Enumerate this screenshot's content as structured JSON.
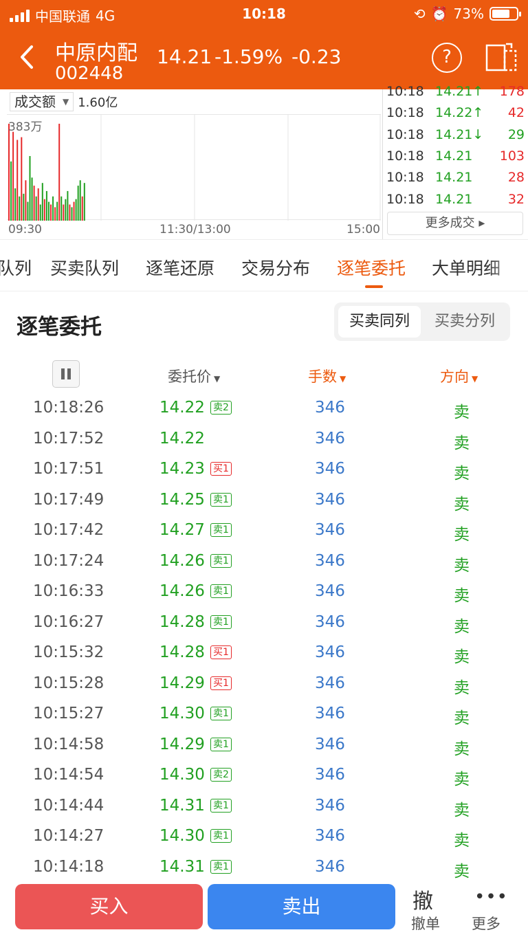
{
  "status_bar": {
    "carrier": "中国联通",
    "network": "4G",
    "time": "10:18",
    "battery": "73%",
    "battery_level": 0.73
  },
  "header": {
    "stock_name": "中原内配",
    "stock_code": "002448",
    "price": "14.21",
    "change_pct": "-1.59%",
    "change": "-0.23",
    "help_label": "?"
  },
  "chart": {
    "metric": "成交额",
    "metric_value": "1.60亿",
    "max_label": "383万",
    "x_labels": [
      "09:30",
      "11:30/13:00",
      "15:00"
    ]
  },
  "chart_data": {
    "type": "bar",
    "ylabel": "",
    "max": 383,
    "unit": "万",
    "bars": [
      {
        "v": 360,
        "c": "red"
      },
      {
        "v": 220,
        "c": "green"
      },
      {
        "v": 330,
        "c": "red"
      },
      {
        "v": 120,
        "c": "green"
      },
      {
        "v": 300,
        "c": "red"
      },
      {
        "v": 90,
        "c": "green"
      },
      {
        "v": 310,
        "c": "red"
      },
      {
        "v": 100,
        "c": "green"
      },
      {
        "v": 150,
        "c": "red"
      },
      {
        "v": 70,
        "c": "green"
      },
      {
        "v": 240,
        "c": "green"
      },
      {
        "v": 160,
        "c": "green"
      },
      {
        "v": 130,
        "c": "red"
      },
      {
        "v": 90,
        "c": "green"
      },
      {
        "v": 120,
        "c": "red"
      },
      {
        "v": 60,
        "c": "green"
      },
      {
        "v": 140,
        "c": "green"
      },
      {
        "v": 80,
        "c": "red"
      },
      {
        "v": 110,
        "c": "green"
      },
      {
        "v": 70,
        "c": "green"
      },
      {
        "v": 60,
        "c": "red"
      },
      {
        "v": 90,
        "c": "green"
      },
      {
        "v": 50,
        "c": "red"
      },
      {
        "v": 70,
        "c": "green"
      },
      {
        "v": 360,
        "c": "red"
      },
      {
        "v": 90,
        "c": "green"
      },
      {
        "v": 60,
        "c": "red"
      },
      {
        "v": 80,
        "c": "green"
      },
      {
        "v": 110,
        "c": "green"
      },
      {
        "v": 60,
        "c": "red"
      },
      {
        "v": 50,
        "c": "green"
      },
      {
        "v": 70,
        "c": "red"
      },
      {
        "v": 80,
        "c": "green"
      },
      {
        "v": 130,
        "c": "green"
      },
      {
        "v": 150,
        "c": "green"
      },
      {
        "v": 90,
        "c": "red"
      },
      {
        "v": 140,
        "c": "green"
      }
    ]
  },
  "ticks": [
    {
      "time": "10:18",
      "price": "14.21↑",
      "vol": "178",
      "vol_color": "red"
    },
    {
      "time": "10:18",
      "price": "14.22↑",
      "vol": "42",
      "vol_color": "red"
    },
    {
      "time": "10:18",
      "price": "14.21↓",
      "vol": "29",
      "vol_color": "green"
    },
    {
      "time": "10:18",
      "price": "14.21",
      "vol": "103",
      "vol_color": "red"
    },
    {
      "time": "10:18",
      "price": "14.21",
      "vol": "28",
      "vol_color": "red"
    },
    {
      "time": "10:18",
      "price": "14.21",
      "vol": "32",
      "vol_color": "red"
    }
  ],
  "more_trades_label": "更多成交 ▸",
  "tabs": [
    "队列",
    "买卖队列",
    "逐笔还原",
    "交易分布",
    "逐笔委托",
    "大单明细"
  ],
  "active_tab": "逐笔委托",
  "section": {
    "title": "逐笔委托",
    "seg_on": "买卖同列",
    "seg_off": "买卖分列"
  },
  "table_headers": {
    "price": "委托价",
    "volume": "手数",
    "direction": "方向"
  },
  "orders": [
    {
      "time": "10:18:26",
      "price": "14.22",
      "badge": "卖2",
      "badge_type": "s",
      "vol": "346",
      "dir": "卖"
    },
    {
      "time": "10:17:52",
      "price": "14.22",
      "badge": "",
      "badge_type": "",
      "vol": "346",
      "dir": "卖"
    },
    {
      "time": "10:17:51",
      "price": "14.23",
      "badge": "买1",
      "badge_type": "b",
      "vol": "346",
      "dir": "卖"
    },
    {
      "time": "10:17:49",
      "price": "14.25",
      "badge": "卖1",
      "badge_type": "s",
      "vol": "346",
      "dir": "卖"
    },
    {
      "time": "10:17:42",
      "price": "14.27",
      "badge": "卖1",
      "badge_type": "s",
      "vol": "346",
      "dir": "卖"
    },
    {
      "time": "10:17:24",
      "price": "14.26",
      "badge": "卖1",
      "badge_type": "s",
      "vol": "346",
      "dir": "卖"
    },
    {
      "time": "10:16:33",
      "price": "14.26",
      "badge": "卖1",
      "badge_type": "s",
      "vol": "346",
      "dir": "卖"
    },
    {
      "time": "10:16:27",
      "price": "14.28",
      "badge": "卖1",
      "badge_type": "s",
      "vol": "346",
      "dir": "卖"
    },
    {
      "time": "10:15:32",
      "price": "14.28",
      "badge": "买1",
      "badge_type": "b",
      "vol": "346",
      "dir": "卖"
    },
    {
      "time": "10:15:28",
      "price": "14.29",
      "badge": "买1",
      "badge_type": "b",
      "vol": "346",
      "dir": "卖"
    },
    {
      "time": "10:15:27",
      "price": "14.30",
      "badge": "卖1",
      "badge_type": "s",
      "vol": "346",
      "dir": "卖"
    },
    {
      "time": "10:14:58",
      "price": "14.29",
      "badge": "卖1",
      "badge_type": "s",
      "vol": "346",
      "dir": "卖"
    },
    {
      "time": "10:14:54",
      "price": "14.30",
      "badge": "卖2",
      "badge_type": "s",
      "vol": "346",
      "dir": "卖"
    },
    {
      "time": "10:14:44",
      "price": "14.31",
      "badge": "卖1",
      "badge_type": "s",
      "vol": "346",
      "dir": "卖"
    },
    {
      "time": "10:14:27",
      "price": "14.30",
      "badge": "卖1",
      "badge_type": "s",
      "vol": "346",
      "dir": "卖"
    },
    {
      "time": "10:14:18",
      "price": "14.31",
      "badge": "卖1",
      "badge_type": "s",
      "vol": "346",
      "dir": "卖"
    }
  ],
  "bottom": {
    "buy": "买入",
    "sell": "卖出",
    "cancel_icon": "撤",
    "cancel": "撤单",
    "more_icon": "•••",
    "more": "更多"
  },
  "colors": {
    "brand": "#ec5a0f",
    "up": "#e6292a",
    "down": "#21a021",
    "volume": "#3b78c9",
    "buy_btn": "#eb5555",
    "sell_btn": "#3b86ef"
  }
}
